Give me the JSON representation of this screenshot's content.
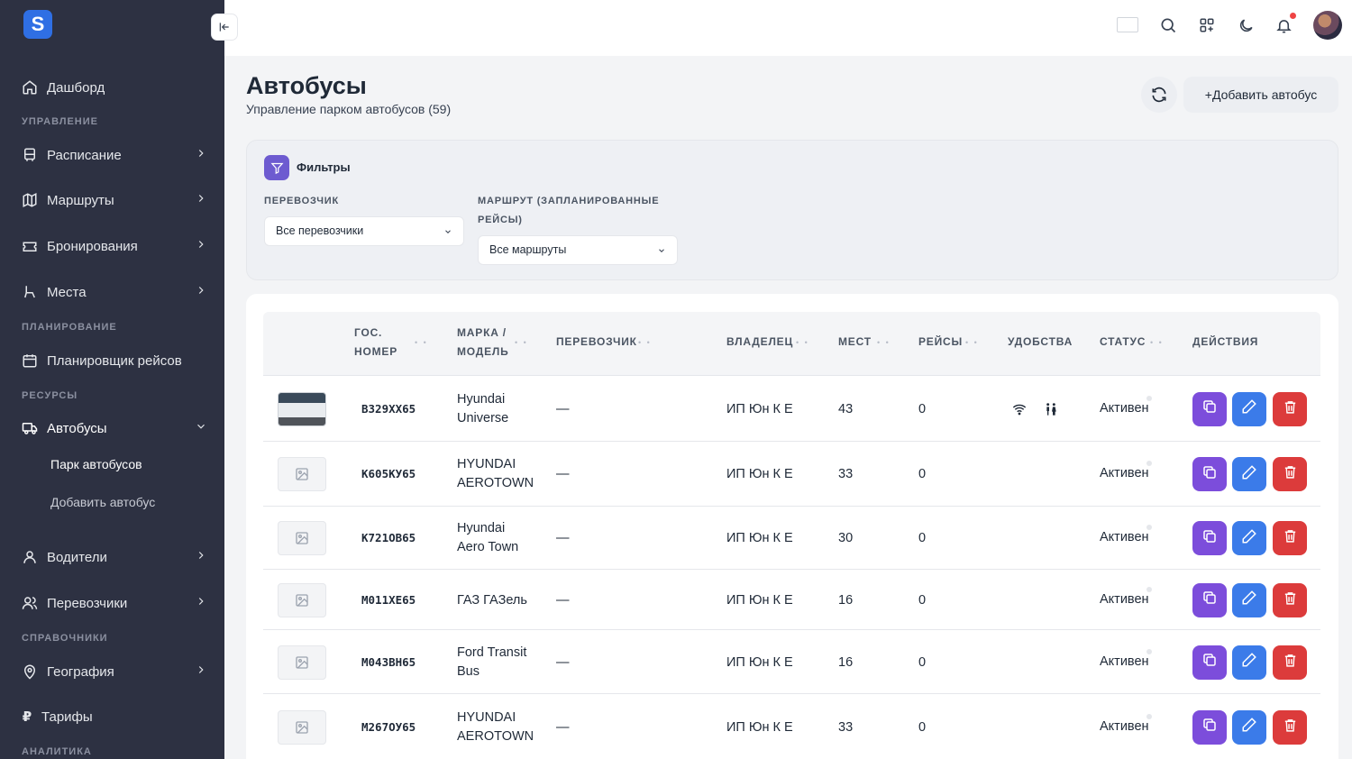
{
  "sidebar": {
    "logo": "S",
    "dashboard": "Дашборд",
    "sec_manage": "УПРАВЛЕНИЕ",
    "schedule": "Расписание",
    "routes": "Маршруты",
    "bookings": "Бронирования",
    "seats": "Места",
    "sec_planning": "ПЛАНИРОВАНИЕ",
    "trip_planner": "Планировщик рейсов",
    "sec_resources": "РЕСУРСЫ",
    "buses": "Автобусы",
    "bus_fleet": "Парк автобусов",
    "add_bus": "Добавить автобус",
    "drivers": "Водители",
    "carriers": "Перевозчики",
    "sec_directories": "СПРАВОЧНИКИ",
    "geography": "География",
    "tariffs": "Тарифы",
    "sec_analytics": "АНАЛИТИКА"
  },
  "header": {
    "title": "Автобусы",
    "subtitle": "Управление парком автобусов (59)",
    "add_button": "+Добавить автобус"
  },
  "filters": {
    "title": "Фильтры",
    "carrier_label_1": "ПЕРЕВОЗЧИК",
    "carrier_value": "Все перевозчики",
    "route_label_1": "МАРШРУТ (ЗАПЛАНИРОВАННЫЕ",
    "route_label_2": "РЕЙСЫ)",
    "route_value": "Все маршруты"
  },
  "table": {
    "columns": {
      "plate_1": "ГОС.",
      "plate_2": "НОМЕР",
      "model_1": "МАРКА /",
      "model_2": "МОДЕЛЬ",
      "carrier": "ПЕРЕВОЗЧИК",
      "owner": "ВЛАДЕЛЕЦ",
      "seats": "МЕСТ",
      "trips": "РЕЙСЫ",
      "amenities": "УДОБСТВА",
      "status": "СТАТУС",
      "actions": "ДЕЙСТВИЯ"
    },
    "rows": [
      {
        "plate": "В329ХХ65",
        "model_1": "Hyundai",
        "model_2": "Universe",
        "carrier": "—",
        "owner": "ИП Юн К Е",
        "seats": "43",
        "trips": "0",
        "status": "Активен",
        "has_photo": true,
        "amenities": [
          "wifi-icon",
          "wc-icon"
        ]
      },
      {
        "plate": "К605КУ65",
        "model_1": "HYUNDAI",
        "model_2": "AEROTOWN",
        "carrier": "—",
        "owner": "ИП Юн К Е",
        "seats": "33",
        "trips": "0",
        "status": "Активен",
        "has_photo": false
      },
      {
        "plate": "К721ОВ65",
        "model_1": "Hyundai",
        "model_2": "Aero Town",
        "carrier": "—",
        "owner": "ИП Юн К Е",
        "seats": "30",
        "trips": "0",
        "status": "Активен",
        "has_photo": false
      },
      {
        "plate": "М011ХЕ65",
        "model_1": "ГАЗ ГАЗель",
        "model_2": "",
        "carrier": "—",
        "owner": "ИП Юн К Е",
        "seats": "16",
        "trips": "0",
        "status": "Активен",
        "has_photo": false
      },
      {
        "plate": "М043ВН65",
        "model_1": "Ford Transit",
        "model_2": "Bus",
        "carrier": "—",
        "owner": "ИП Юн К Е",
        "seats": "16",
        "trips": "0",
        "status": "Активен",
        "has_photo": false
      },
      {
        "plate": "М267ОУ65",
        "model_1": "HYUNDAI",
        "model_2": "AEROTOWN",
        "carrier": "—",
        "owner": "ИП Юн К Е",
        "seats": "33",
        "trips": "0",
        "status": "Активен",
        "has_photo": false
      }
    ]
  },
  "colors": {
    "sidebar_bg": "#2d3142",
    "accent_blue": "#3b7be9",
    "accent_purple": "#7c4ddb",
    "danger_red": "#dc3b3b"
  }
}
